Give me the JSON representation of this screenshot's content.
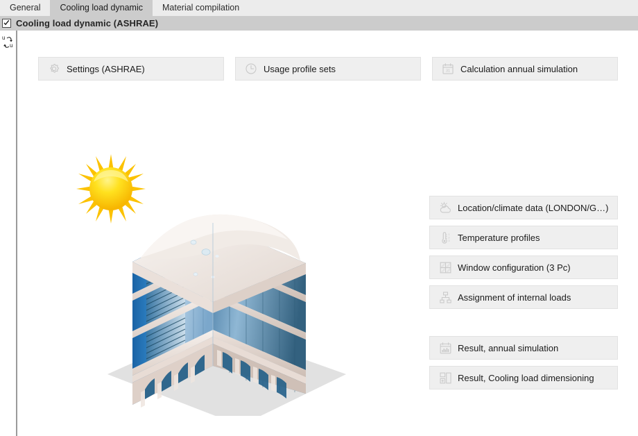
{
  "tabs": [
    {
      "label": "General",
      "active": false
    },
    {
      "label": "Cooling load dynamic",
      "active": true
    },
    {
      "label": "Material compilation",
      "active": false
    }
  ],
  "header": {
    "title": "Cooling load dynamic (ASHRAE)",
    "checkbox_checked": true,
    "checkmark_icon": "check-icon"
  },
  "left_rail": {
    "rotate_text_icon": "rotate-text-icon",
    "pin_icon": "pushpin-icon"
  },
  "toolbar": {
    "settings_label": "Settings (ASHRAE)",
    "settings_icon": "gear-icon",
    "usage_label": "Usage profile sets",
    "usage_icon": "clock-icon",
    "calc_label": "Calculation annual simulation",
    "calc_icon": "calendar-icon",
    "calendar_day": "31"
  },
  "side_panel": {
    "group_a": [
      {
        "label": "Location/climate data (LONDON/G…)",
        "icon": "sun-cloud-icon"
      },
      {
        "label": "Temperature profiles",
        "icon": "thermometer-icon"
      },
      {
        "label": "Window configuration (3 Pc)",
        "icon": "window-grid-icon"
      },
      {
        "label": "Assignment of internal loads",
        "icon": "hierarchy-tree-icon"
      }
    ],
    "group_b": [
      {
        "label": "Result, annual simulation",
        "icon": "calendar-chart-icon"
      },
      {
        "label": "Result, Cooling load dimensioning",
        "icon": "panels-layout-icon"
      }
    ]
  },
  "illustration": {
    "name": "isometric-office-building-with-sun",
    "sun_icon": "sun-icon",
    "building_icon": "office-building-icon"
  },
  "colors": {
    "tabstrip_bg": "#ececec",
    "active_tab_bg": "#cccccc",
    "header_bg": "#cccccc",
    "button_bg": "#efefef",
    "button_border": "#e2e2e2",
    "text": "#1b1b1b",
    "icon_gray": "#c9c9c9",
    "sun_yellow": "#ffd700",
    "building_blue": "#2e6da4",
    "building_cream": "#e8ded7"
  }
}
